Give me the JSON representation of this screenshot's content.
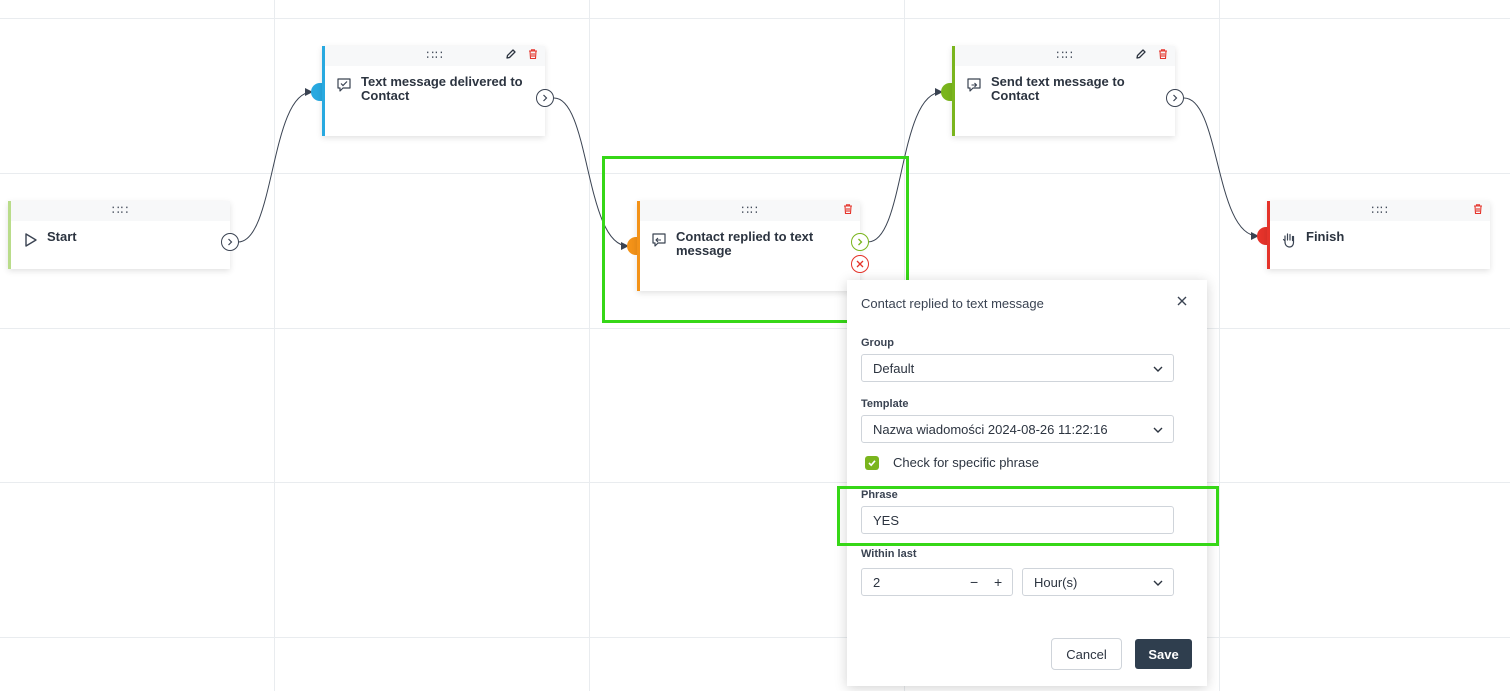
{
  "canvas": {
    "nodes": {
      "start": {
        "title": "Start",
        "drag_handle": "∷∷",
        "accent": "#b9dc8a",
        "icon": "play-icon"
      },
      "delivered": {
        "title": "Text message delivered to Contact",
        "drag_handle": "∷∷",
        "accent": "#28a9e0",
        "icon": "message-check-icon"
      },
      "replied": {
        "title": "Contact replied to text message",
        "drag_handle": "∷∷",
        "accent": "#f39218",
        "icon": "message-reply-icon"
      },
      "send": {
        "title": "Send text message to Contact",
        "drag_handle": "∷∷",
        "accent": "#7ab51d",
        "icon": "message-send-icon"
      },
      "finish": {
        "title": "Finish",
        "drag_handle": "∷∷",
        "accent": "#e5332a",
        "icon": "hand-stop-icon"
      }
    },
    "colors": {
      "delete": "#e5332a",
      "success_port": "#7ab51d",
      "failure_port": "#e5332a",
      "highlight": "#36d717"
    }
  },
  "panel": {
    "title": "Contact replied to text message",
    "group": {
      "label": "Group",
      "value": "Default"
    },
    "template": {
      "label": "Template",
      "value": "Nazwa wiadomości 2024-08-26 11:22:16"
    },
    "check_phrase": {
      "label": "Check for specific phrase",
      "checked": true
    },
    "phrase": {
      "label": "Phrase",
      "value": "YES"
    },
    "within_last": {
      "label": "Within last",
      "value": "2",
      "minus": "−",
      "plus": "+",
      "unit": "Hour(s)"
    },
    "buttons": {
      "cancel": "Cancel",
      "save": "Save"
    }
  }
}
